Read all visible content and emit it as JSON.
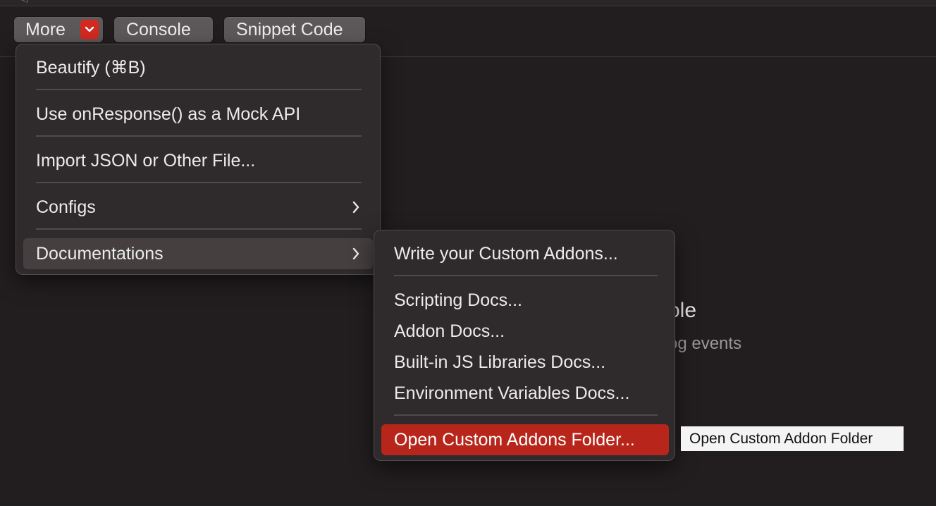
{
  "toolbar": {
    "more_label": "More",
    "console_label": "Console",
    "snippet_label": "Snippet Code"
  },
  "background": {
    "heading_fragment": "ole",
    "subtext_fragment": "og events"
  },
  "main_menu": {
    "items": [
      {
        "label": "Beautify (⌘B)"
      },
      {
        "label": "Use onResponse() as a Mock API"
      },
      {
        "label": "Import JSON or Other File..."
      },
      {
        "label": "Configs",
        "has_submenu": true
      },
      {
        "label": "Documentations",
        "has_submenu": true,
        "highlighted": true
      }
    ]
  },
  "submenu": {
    "items": [
      {
        "label": "Write your Custom Addons..."
      },
      {
        "label": "Scripting Docs..."
      },
      {
        "label": "Addon Docs..."
      },
      {
        "label": "Built-in JS Libraries Docs..."
      },
      {
        "label": "Environment Variables Docs..."
      },
      {
        "label": "Open Custom Addons Folder...",
        "selected": true
      }
    ]
  },
  "tooltip": {
    "text": "Open Custom Addon Folder"
  },
  "colors": {
    "accent": "#b8261b",
    "more_arrow": "#d22a20",
    "background": "#221e1f",
    "menu_bg": "#2f2b2c"
  },
  "icons": {
    "more_dropdown": "chevron-down-icon",
    "submenu_indicator": "chevron-right-icon"
  }
}
